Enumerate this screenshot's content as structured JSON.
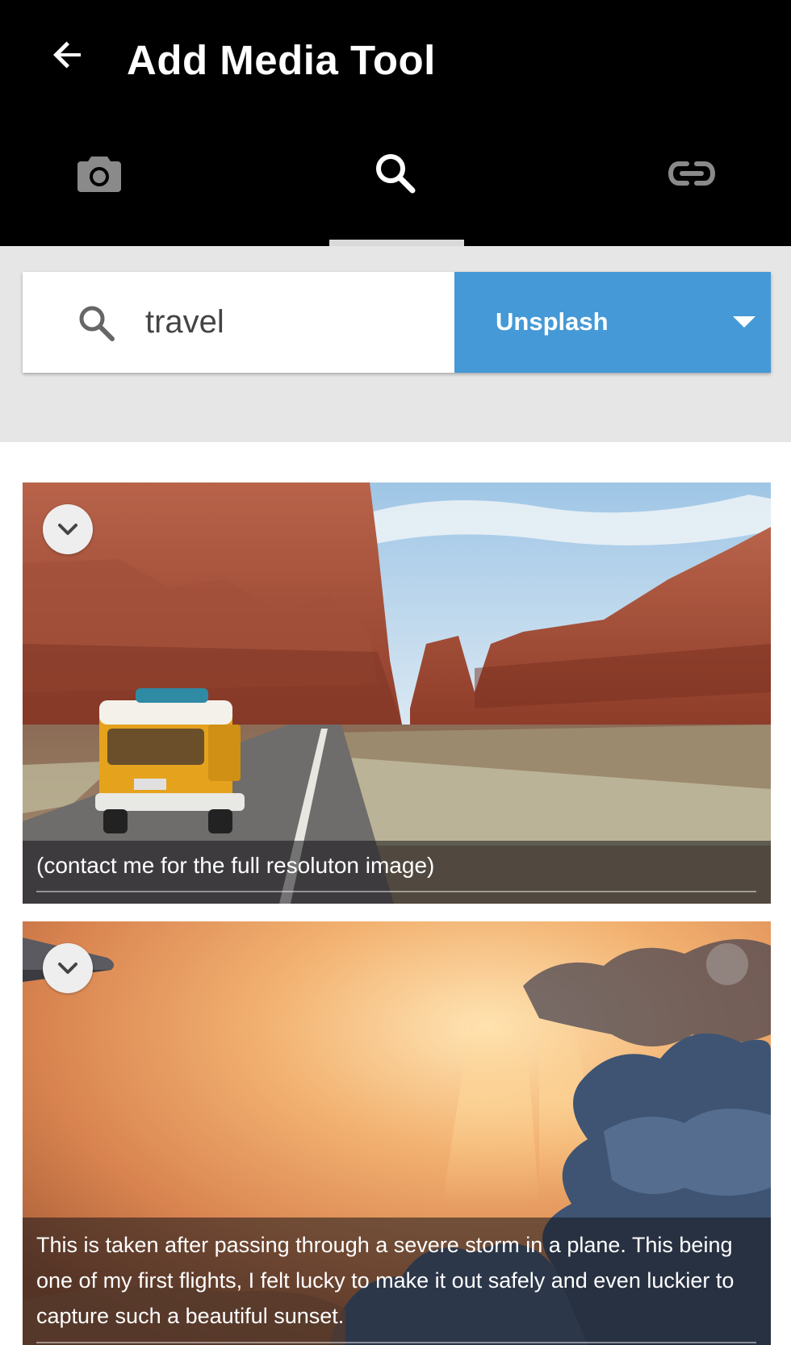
{
  "header": {
    "title": "Add Media Tool",
    "back_icon": "arrow-left-icon"
  },
  "tabs": [
    {
      "name": "camera",
      "icon": "camera-icon",
      "active": false
    },
    {
      "name": "search",
      "icon": "search-icon",
      "active": true
    },
    {
      "name": "link",
      "icon": "link-icon",
      "active": false
    }
  ],
  "search": {
    "query": "travel",
    "source_selected": "Unsplash"
  },
  "results": [
    {
      "caption": "(contact me for the full resoluton image)"
    },
    {
      "caption": "This is taken after passing through a severe storm in a plane. This being one of my first flights, I felt lucky to make it out safely and even luckier to capture such a beautiful sunset."
    }
  ],
  "colors": {
    "header_bg": "#000000",
    "accent": "#4499d6",
    "search_area_bg": "#e6e6e6"
  }
}
